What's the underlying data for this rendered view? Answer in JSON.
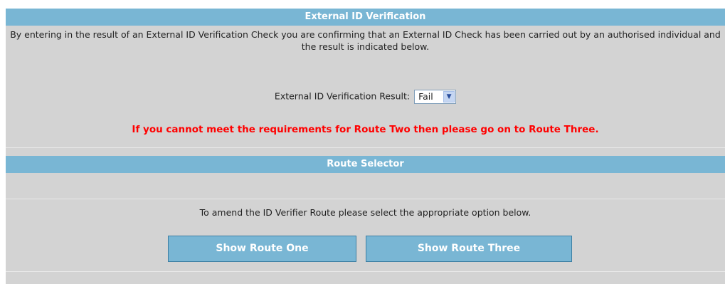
{
  "verification": {
    "title": "External ID Verification",
    "intro": "By entering in the result of an External ID Verification Check you are confirming that an External ID Check has been carried out by an authorised individual and the result is indicated below.",
    "result_label": "External ID Verification Result:",
    "result_value": "Fail",
    "warning": "If you cannot meet the requirements for Route Two then please go on to Route Three."
  },
  "route_selector": {
    "title": "Route Selector",
    "instruction": "To amend the ID Verifier Route please select the appropriate option below.",
    "button_one": "Show Route One",
    "button_three": "Show Route Three"
  },
  "colors": {
    "header": "#79b6d4",
    "panel": "#d3d3d3",
    "warning": "#ff0000"
  }
}
